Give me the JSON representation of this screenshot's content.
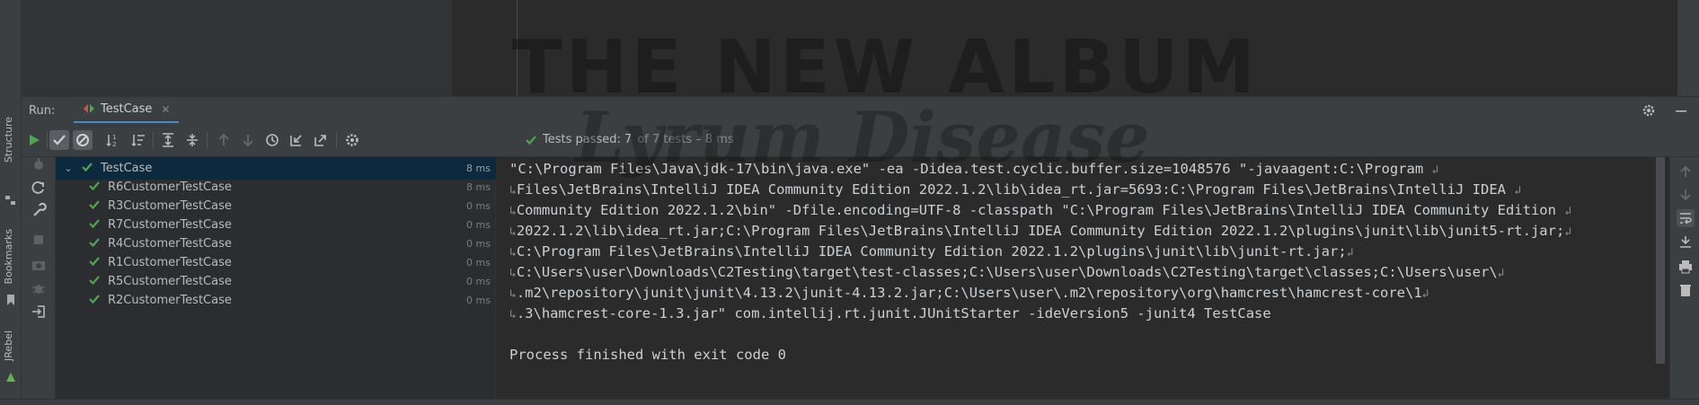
{
  "watermark": {
    "line1": "THE NEW ALBUM",
    "line2": "Lyrum Disease"
  },
  "sidebar": {
    "structure": "Structure",
    "bookmarks": "Bookmarks",
    "jrebel": "JRebel",
    "more": "»"
  },
  "run": {
    "label": "Run:",
    "tab_title": "TestCase",
    "tab_close": "✕"
  },
  "toolbar": {
    "icons": [
      "rerun-icon",
      "show-passed-icon",
      "show-ignored-icon",
      "sort-alpha-icon",
      "sort-duration-icon",
      "expand-all-icon",
      "collapse-all-icon",
      "prev-failed-icon",
      "next-failed-icon",
      "history-icon",
      "import-icon",
      "export-icon",
      "settings-icon"
    ],
    "status_main": "Tests passed: 7",
    "status_sub": "of 7 tests – 8 ms"
  },
  "tree": [
    {
      "name": "TestCase",
      "time": "8 ms",
      "root": true
    },
    {
      "name": "R6CustomerTestCase",
      "time": "8 ms"
    },
    {
      "name": "R3CustomerTestCase",
      "time": "0 ms"
    },
    {
      "name": "R7CustomerTestCase",
      "time": "0 ms"
    },
    {
      "name": "R4CustomerTestCase",
      "time": "0 ms"
    },
    {
      "name": "R1CustomerTestCase",
      "time": "0 ms"
    },
    {
      "name": "R5CustomerTestCase",
      "time": "0 ms"
    },
    {
      "name": "R2CustomerTestCase",
      "time": "0 ms"
    }
  ],
  "console": {
    "lines": [
      "\"C:\\Program Files\\Java\\jdk-17\\bin\\java.exe\" -ea -Didea.test.cyclic.buffer.size=1048576 \"-javaagent:C:\\Program",
      "Files\\JetBrains\\IntelliJ IDEA Community Edition 2022.1.2\\lib\\idea_rt.jar=5693:C:\\Program Files\\JetBrains\\IntelliJ IDEA",
      "Community Edition 2022.1.2\\bin\" -Dfile.encoding=UTF-8 -classpath \"C:\\Program Files\\JetBrains\\IntelliJ IDEA Community Edition",
      "2022.1.2\\lib\\idea_rt.jar;C:\\Program Files\\JetBrains\\IntelliJ IDEA Community Edition 2022.1.2\\plugins\\junit\\lib\\junit5-rt.jar;",
      "C:\\Program Files\\JetBrains\\IntelliJ IDEA Community Edition 2022.1.2\\plugins\\junit\\lib\\junit-rt.jar;",
      "C:\\Users\\user\\Downloads\\C2Testing\\target\\test-classes;C:\\Users\\user\\Downloads\\C2Testing\\target\\classes;C:\\Users\\user\\",
      ".m2\\repository\\junit\\junit\\4.13.2\\junit-4.13.2.jar;C:\\Users\\user\\.m2\\repository\\org\\hamcrest\\hamcrest-core\\1",
      ".3\\hamcrest-core-1.3.jar\" com.intellij.rt.junit.JUnitStarter -ideVersion5 -junit4 TestCase",
      "",
      "Process finished with exit code 0"
    ],
    "wrap_marker": "↲",
    "continue_marker": "↳"
  },
  "colors": {
    "check_green": "#4fa64f",
    "accent_blue": "#4a88c7",
    "selection": "#0d293e"
  }
}
